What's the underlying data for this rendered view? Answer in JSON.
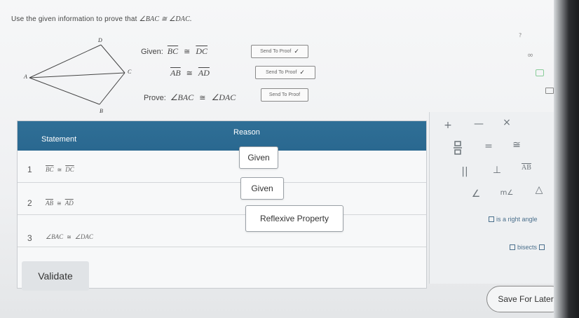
{
  "instruction": {
    "prefix": "Use the given information to prove that ",
    "statement": "∠BAC ≅ ∠DAC."
  },
  "diagram": {
    "points": {
      "A": "A",
      "B": "B",
      "C": "C",
      "D": "D"
    }
  },
  "given": {
    "label": "Given:",
    "line1": {
      "left": "BC",
      "right": "DC",
      "button": "Send To Proof"
    },
    "line2": {
      "left": "AB",
      "right": "AD",
      "button": "Send To Proof"
    }
  },
  "prove": {
    "label": "Prove:",
    "left": "∠BAC",
    "right": "∠DAC",
    "button": "Send To Proof"
  },
  "congruent_symbol": "≅",
  "table": {
    "statement_header": "Statement",
    "reason_header": "Reason",
    "rows": [
      {
        "num": "1",
        "left": "BC",
        "right": "DC",
        "reason": "Given"
      },
      {
        "num": "2",
        "left": "AB",
        "right": "AD",
        "reason": "Given"
      },
      {
        "num": "3",
        "left": "∠BAC",
        "right": "∠DAC",
        "reason": "Reflexive Property"
      }
    ]
  },
  "validate_label": "Validate",
  "palette": {
    "row1": [
      "+",
      "—",
      "×"
    ],
    "row2": [
      "=",
      "≅"
    ],
    "row3": [
      "||",
      "⊥",
      "AB"
    ],
    "row4": [
      "∠",
      "m∠",
      "△"
    ],
    "opt_right_angle": "is a right angle",
    "opt_bisects": "bisects"
  },
  "save_label": "Save For Later",
  "side_icons": {
    "infinity": "∞"
  }
}
